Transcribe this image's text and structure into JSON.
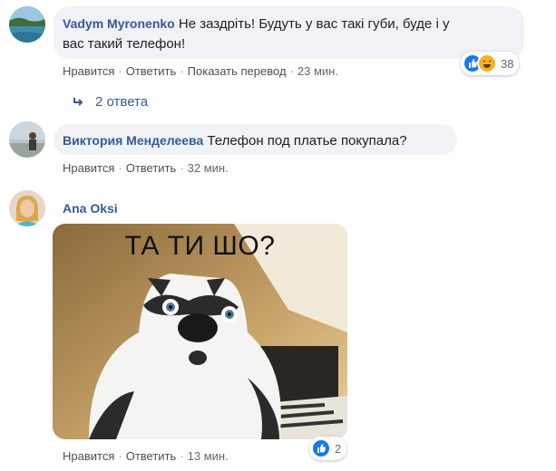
{
  "comments": [
    {
      "author": "Vadym Myronenko",
      "text_line1": "Не заздріть! Будуть у вас такі губи, буде і у",
      "text_line2": "вас такий телефон!",
      "like": "Нравится",
      "reply": "Ответить",
      "translate": "Показать перевод",
      "time": "23 мин.",
      "reaction_count": "38",
      "replies_label": "2 ответа"
    },
    {
      "author": "Виктория Менделеева",
      "text": "Телефон под платье покупала?",
      "like": "Нравится",
      "reply": "Ответить",
      "time": "32 мин."
    },
    {
      "author": "Ana Oksi",
      "meme_caption": "ТА ТИ ШО?",
      "like": "Нравится",
      "reply": "Ответить",
      "time": "13 мин.",
      "reaction_count": "2"
    }
  ],
  "colors": {
    "author": "#385898",
    "bubble": "#f0f2f5",
    "like_blue": "#1877f2",
    "haha_yellow": "#f7b125"
  },
  "icons": [
    "avatar-lake",
    "avatar-person-beach",
    "avatar-woman-blonde",
    "like-reaction-icon",
    "haha-reaction-icon",
    "reply-arrow-icon"
  ]
}
